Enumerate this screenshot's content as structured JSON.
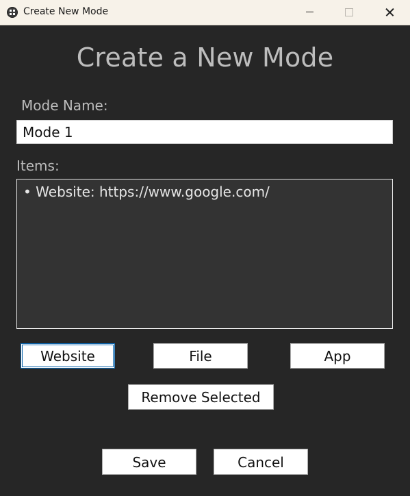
{
  "window": {
    "title": "Create New Mode",
    "icon": "app-icon"
  },
  "heading": "Create a New Mode",
  "mode_name": {
    "label": "Mode Name:",
    "value": "Mode 1"
  },
  "items": {
    "label": "Items:",
    "list": [
      "• Website: https://www.google.com/"
    ]
  },
  "buttons": {
    "website": "Website",
    "file": "File",
    "app": "App",
    "remove_selected": "Remove Selected",
    "save": "Save",
    "cancel": "Cancel"
  },
  "colors": {
    "background": "#262626",
    "titlebar": "#f7f2e9",
    "text": "#bdbdbd",
    "list_background": "#333333",
    "focus": "#0a64ad"
  }
}
